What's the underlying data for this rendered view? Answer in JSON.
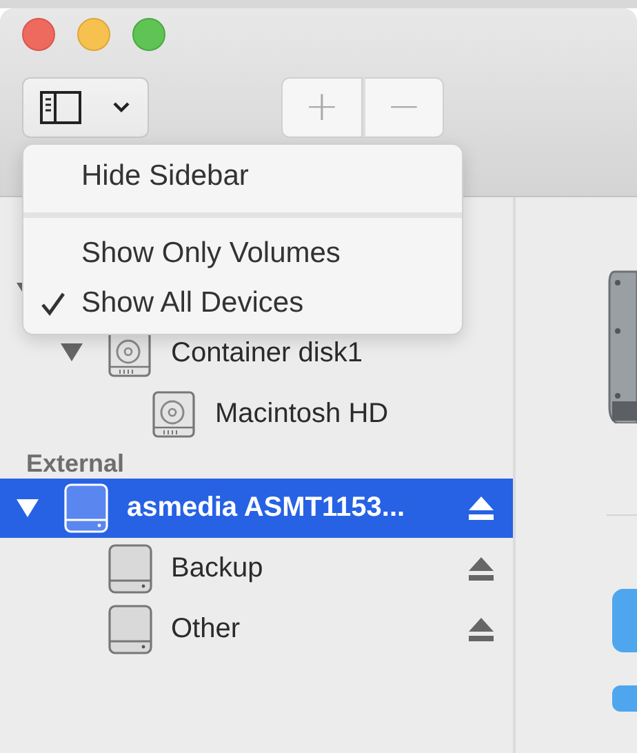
{
  "toolbar": {
    "sidebar_button": {
      "expanded": true
    },
    "segmented": [
      "+",
      "−"
    ]
  },
  "menu": {
    "items": [
      {
        "kind": "item",
        "label": "Hide Sidebar",
        "checked": false
      },
      {
        "kind": "separator"
      },
      {
        "kind": "item",
        "label": "Show Only Volumes",
        "checked": false
      },
      {
        "kind": "item",
        "label": "Show All Devices",
        "checked": true
      }
    ]
  },
  "sidebar": {
    "sections": [
      {
        "items": [
          {
            "expanded": true,
            "children": [
              {
                "label": "Container disk1",
                "expanded": true,
                "kind": "internal",
                "children": [
                  {
                    "label": "Macintosh HD",
                    "kind": "internal",
                    "eject": false,
                    "selected": false
                  }
                ],
                "eject": false,
                "selected": false
              }
            ]
          }
        ]
      },
      {
        "header": "External",
        "items": [
          {
            "label": "asmedia ASMT1153...",
            "expanded": true,
            "kind": "external",
            "eject": true,
            "selected": true,
            "children": [
              {
                "label": "Backup",
                "kind": "external",
                "eject": true,
                "selected": false
              },
              {
                "label": "Other",
                "kind": "external",
                "eject": true,
                "selected": false
              }
            ]
          }
        ]
      }
    ]
  }
}
